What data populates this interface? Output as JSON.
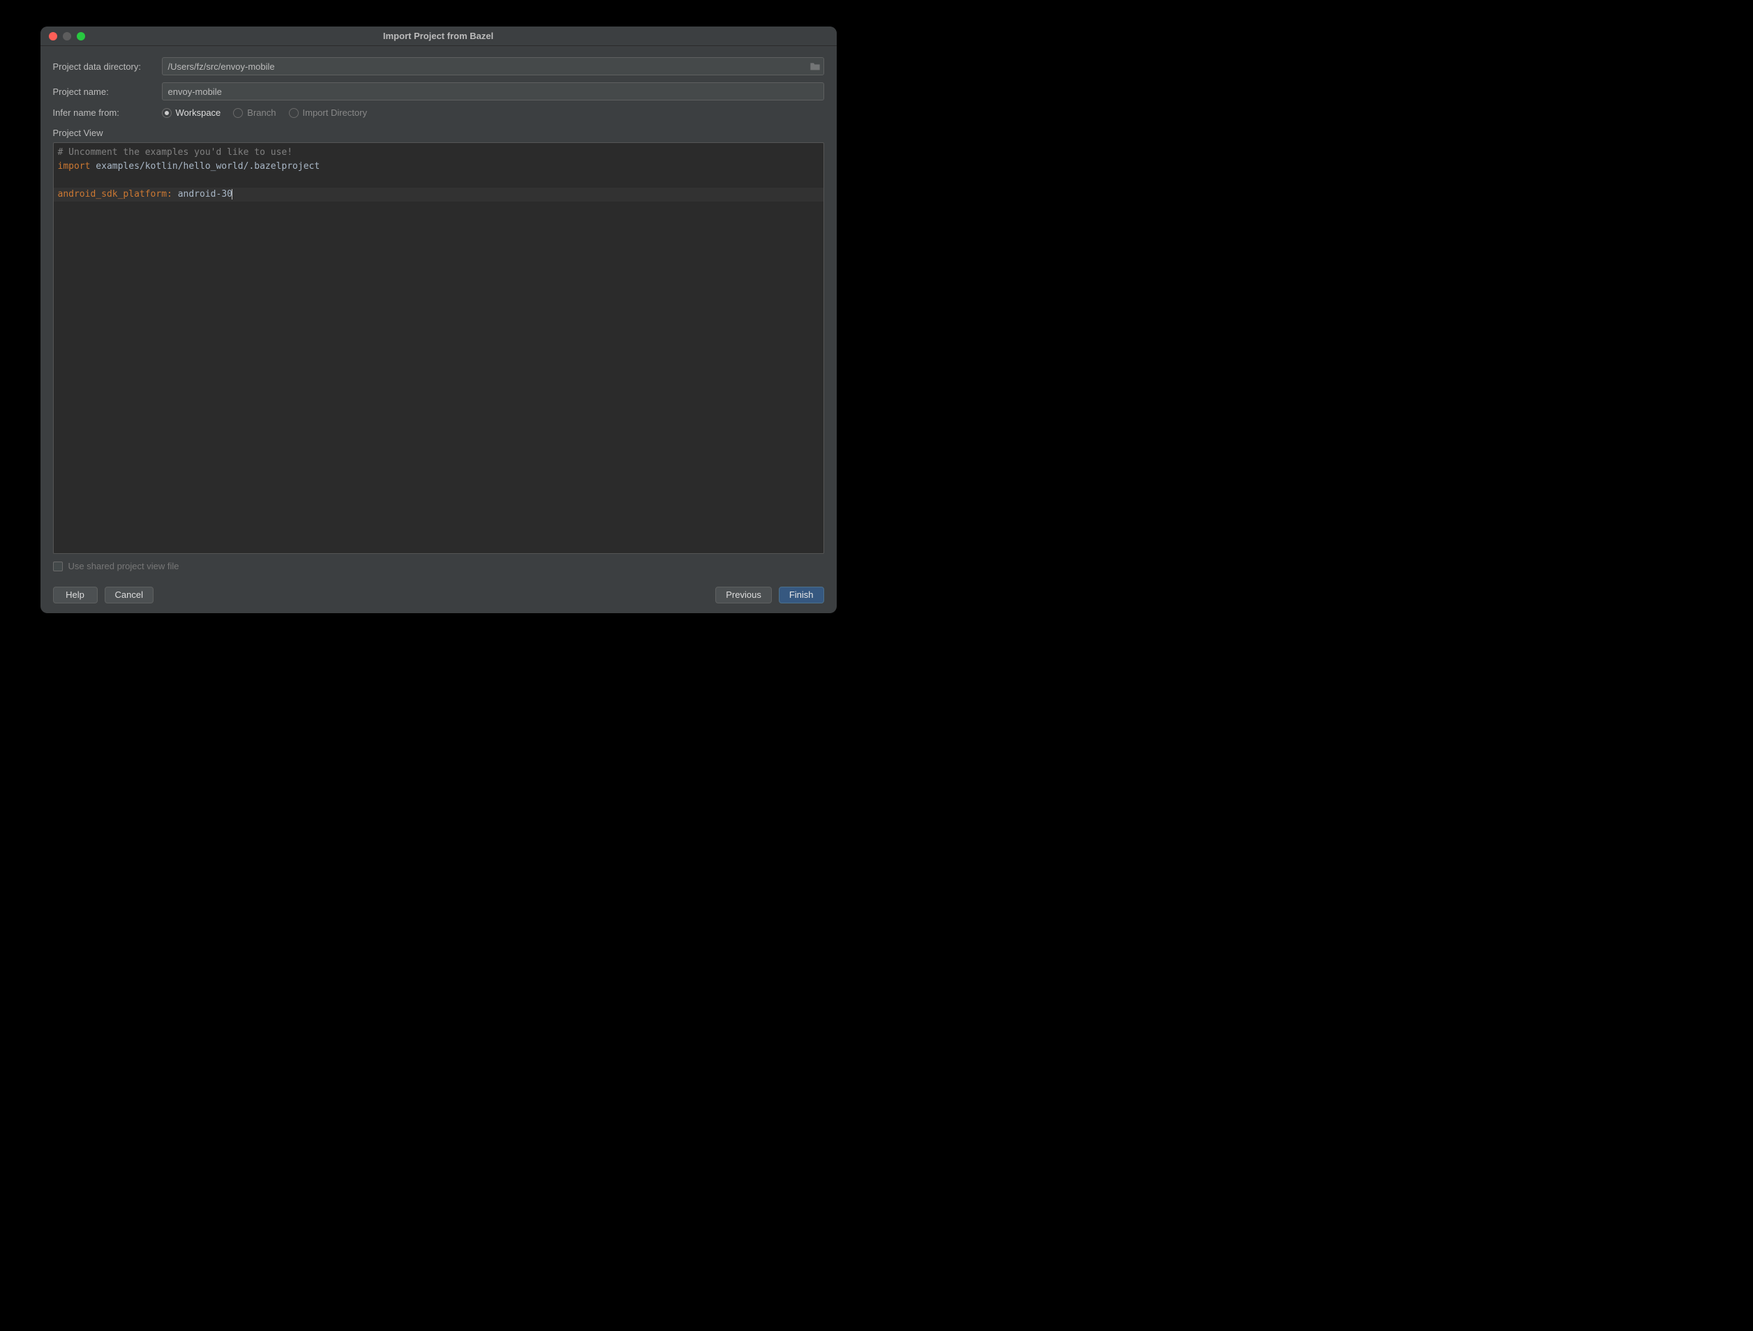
{
  "window": {
    "title": "Import Project from Bazel"
  },
  "form": {
    "data_dir_label": "Project data directory:",
    "data_dir_value": "/Users/fz/src/envoy-mobile",
    "project_name_label": "Project name:",
    "project_name_value": "envoy-mobile",
    "infer_label": "Infer name from:",
    "infer_options": {
      "workspace": "Workspace",
      "branch": "Branch",
      "import_dir": "Import Directory"
    },
    "project_view_label": "Project View"
  },
  "editor": {
    "comment": "# Uncomment the examples you'd like to use!",
    "import_kw": "import",
    "import_path": " examples/kotlin/hello_world/.bazelproject",
    "sdk_key": "android_sdk_platform:",
    "sdk_value": " android-30"
  },
  "checkbox": {
    "shared_label": "Use shared project view file"
  },
  "buttons": {
    "help": "Help",
    "cancel": "Cancel",
    "previous": "Previous",
    "finish": "Finish"
  }
}
